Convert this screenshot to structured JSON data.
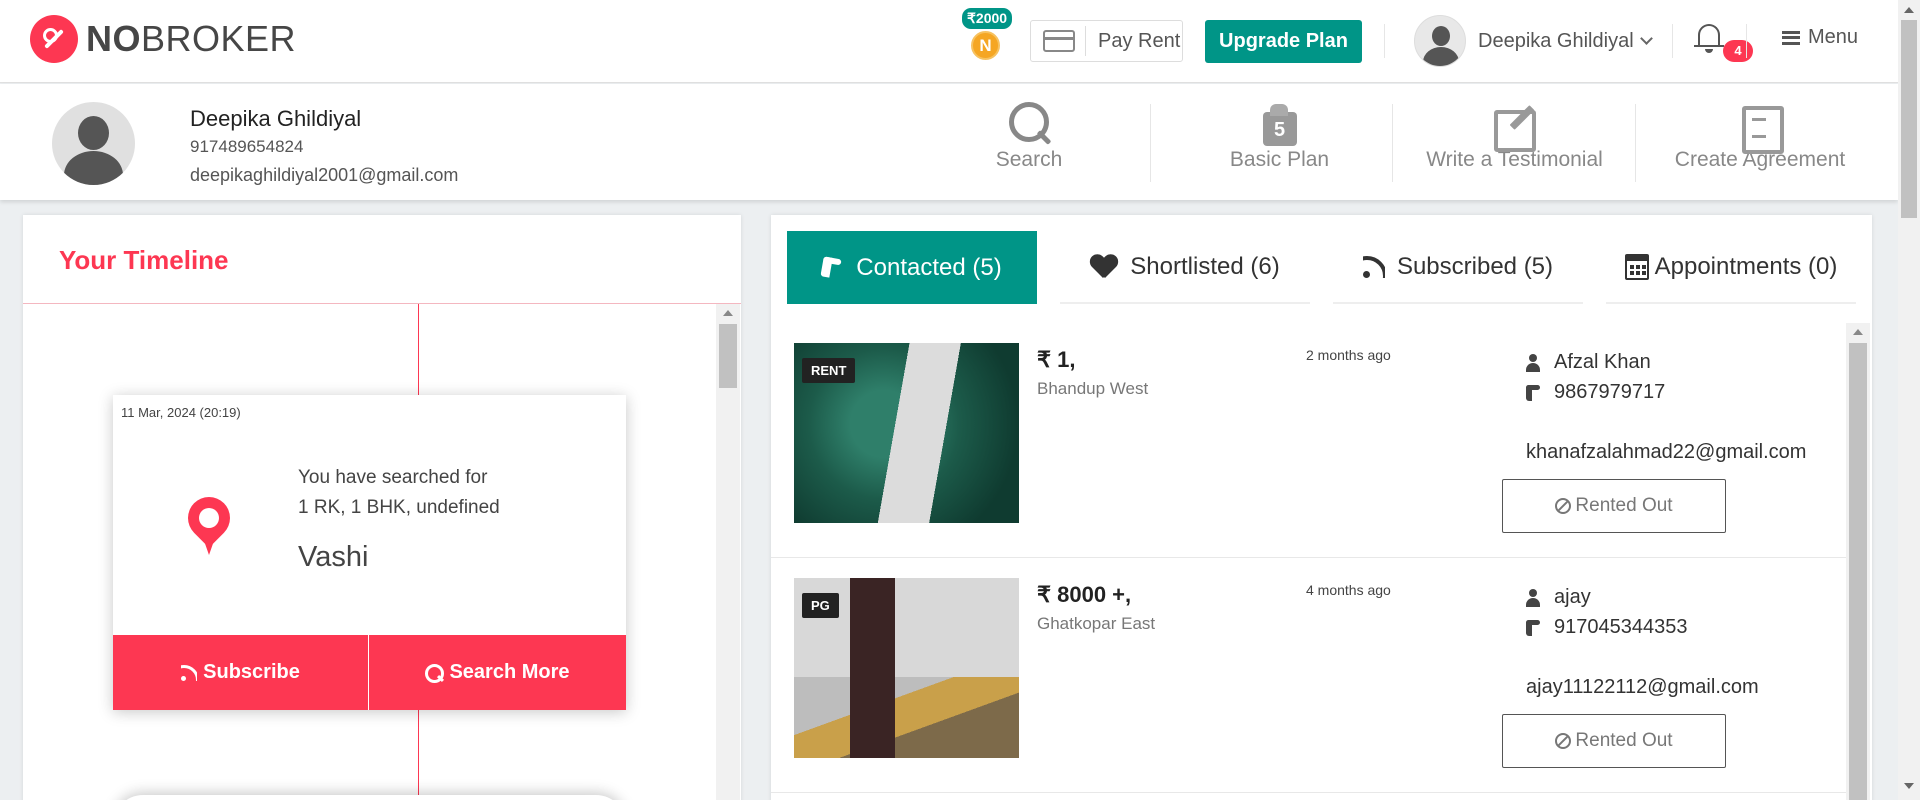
{
  "header": {
    "logo_no": "NO",
    "logo_broker": "BROKER",
    "coin_amount": "₹2000",
    "coin_letter": "N",
    "pay_rent_label": "Pay Rent",
    "upgrade_label": "Upgrade Plan",
    "user_name": "Deepika Ghildiyal",
    "notification_count": "4",
    "menu_label": "Menu",
    "icons": [
      "logo-icon",
      "credit-card-icon",
      "chevron-down-icon",
      "bell-icon",
      "hamburger-icon"
    ]
  },
  "profile": {
    "name": "Deepika Ghildiyal",
    "phone": "917489654824",
    "email": "deepikaghildiyal2001@gmail.com",
    "actions": [
      {
        "label": "Search",
        "icon": "search-icon"
      },
      {
        "label": "Basic Plan",
        "icon": "plan-icon"
      },
      {
        "label": "Write a Testimonial",
        "icon": "pen-icon"
      },
      {
        "label": "Create Agreement",
        "icon": "agreement-icon"
      }
    ]
  },
  "timeline": {
    "title": "Your Timeline",
    "card": {
      "date": "11 Mar, 2024 (20:19)",
      "line1": "You have searched for",
      "line2": "1 RK, 1 BHK, undefined",
      "location": "Vashi",
      "subscribe_label": "Subscribe",
      "search_more_label": "Search More"
    }
  },
  "tabs": [
    {
      "label": "Contacted (5)",
      "icon": "phone-icon",
      "active": true
    },
    {
      "label": "Shortlisted (6)",
      "icon": "heart-icon",
      "active": false
    },
    {
      "label": "Subscribed (5)",
      "icon": "rss-icon",
      "active": false
    },
    {
      "label": "Appointments (0)",
      "icon": "calendar-icon",
      "active": false
    }
  ],
  "listings": [
    {
      "badge": "RENT",
      "price_symbol": "₹",
      "price": "1,",
      "location": "Bhandup West",
      "time_ago": "2 months ago",
      "owner": "Afzal Khan",
      "phone": "9867979717",
      "email": "khanafzalahmad22@gmail.com",
      "status": "Rented Out"
    },
    {
      "badge": "PG",
      "price_symbol": "₹",
      "price": "8000 +,",
      "location": "Ghatkopar East",
      "time_ago": "4 months ago",
      "owner": "ajay",
      "phone": "917045344353",
      "email": "ajay11122112@gmail.com",
      "status": "Rented Out"
    }
  ],
  "colors": {
    "brand_red": "#fd3752",
    "teal": "#009587",
    "coin_gold": "#f5a623"
  }
}
